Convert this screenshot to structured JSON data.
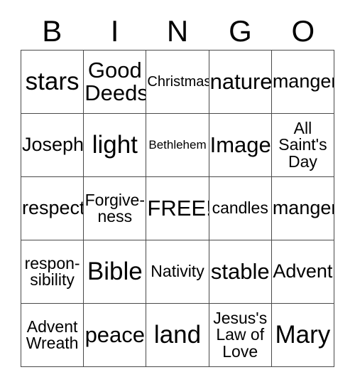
{
  "card": {
    "header_letters": [
      "B",
      "I",
      "N",
      "G",
      "O"
    ],
    "rows": [
      [
        {
          "text": "stars",
          "size": "xxl"
        },
        {
          "text": "Good\nDeeds",
          "size": "xl"
        },
        {
          "text": "Christmas",
          "size": "s"
        },
        {
          "text": "nature",
          "size": "xl"
        },
        {
          "text": "manger",
          "size": "l"
        }
      ],
      [
        {
          "text": "Joseph",
          "size": "l"
        },
        {
          "text": "light",
          "size": "xxl"
        },
        {
          "text": "Bethlehem",
          "size": "xs"
        },
        {
          "text": "Image",
          "size": "xl"
        },
        {
          "text": "All\nSaint's\nDay",
          "size": "m"
        }
      ],
      [
        {
          "text": "respect",
          "size": "l"
        },
        {
          "text": "Forgive-\nness",
          "size": "m"
        },
        {
          "text": "FREE!",
          "size": "xl"
        },
        {
          "text": "candles",
          "size": "m"
        },
        {
          "text": "manger",
          "size": "l"
        }
      ],
      [
        {
          "text": "respon-\nsibility",
          "size": "m"
        },
        {
          "text": "Bible",
          "size": "xxl"
        },
        {
          "text": "Nativity",
          "size": "m"
        },
        {
          "text": "stable",
          "size": "xl"
        },
        {
          "text": "Advent",
          "size": "l"
        }
      ],
      [
        {
          "text": "Advent\nWreath",
          "size": "m"
        },
        {
          "text": "peace",
          "size": "xl"
        },
        {
          "text": "land",
          "size": "xxl"
        },
        {
          "text": "Jesus's\nLaw of\nLove",
          "size": "m"
        },
        {
          "text": "Mary",
          "size": "xxl"
        }
      ]
    ]
  }
}
